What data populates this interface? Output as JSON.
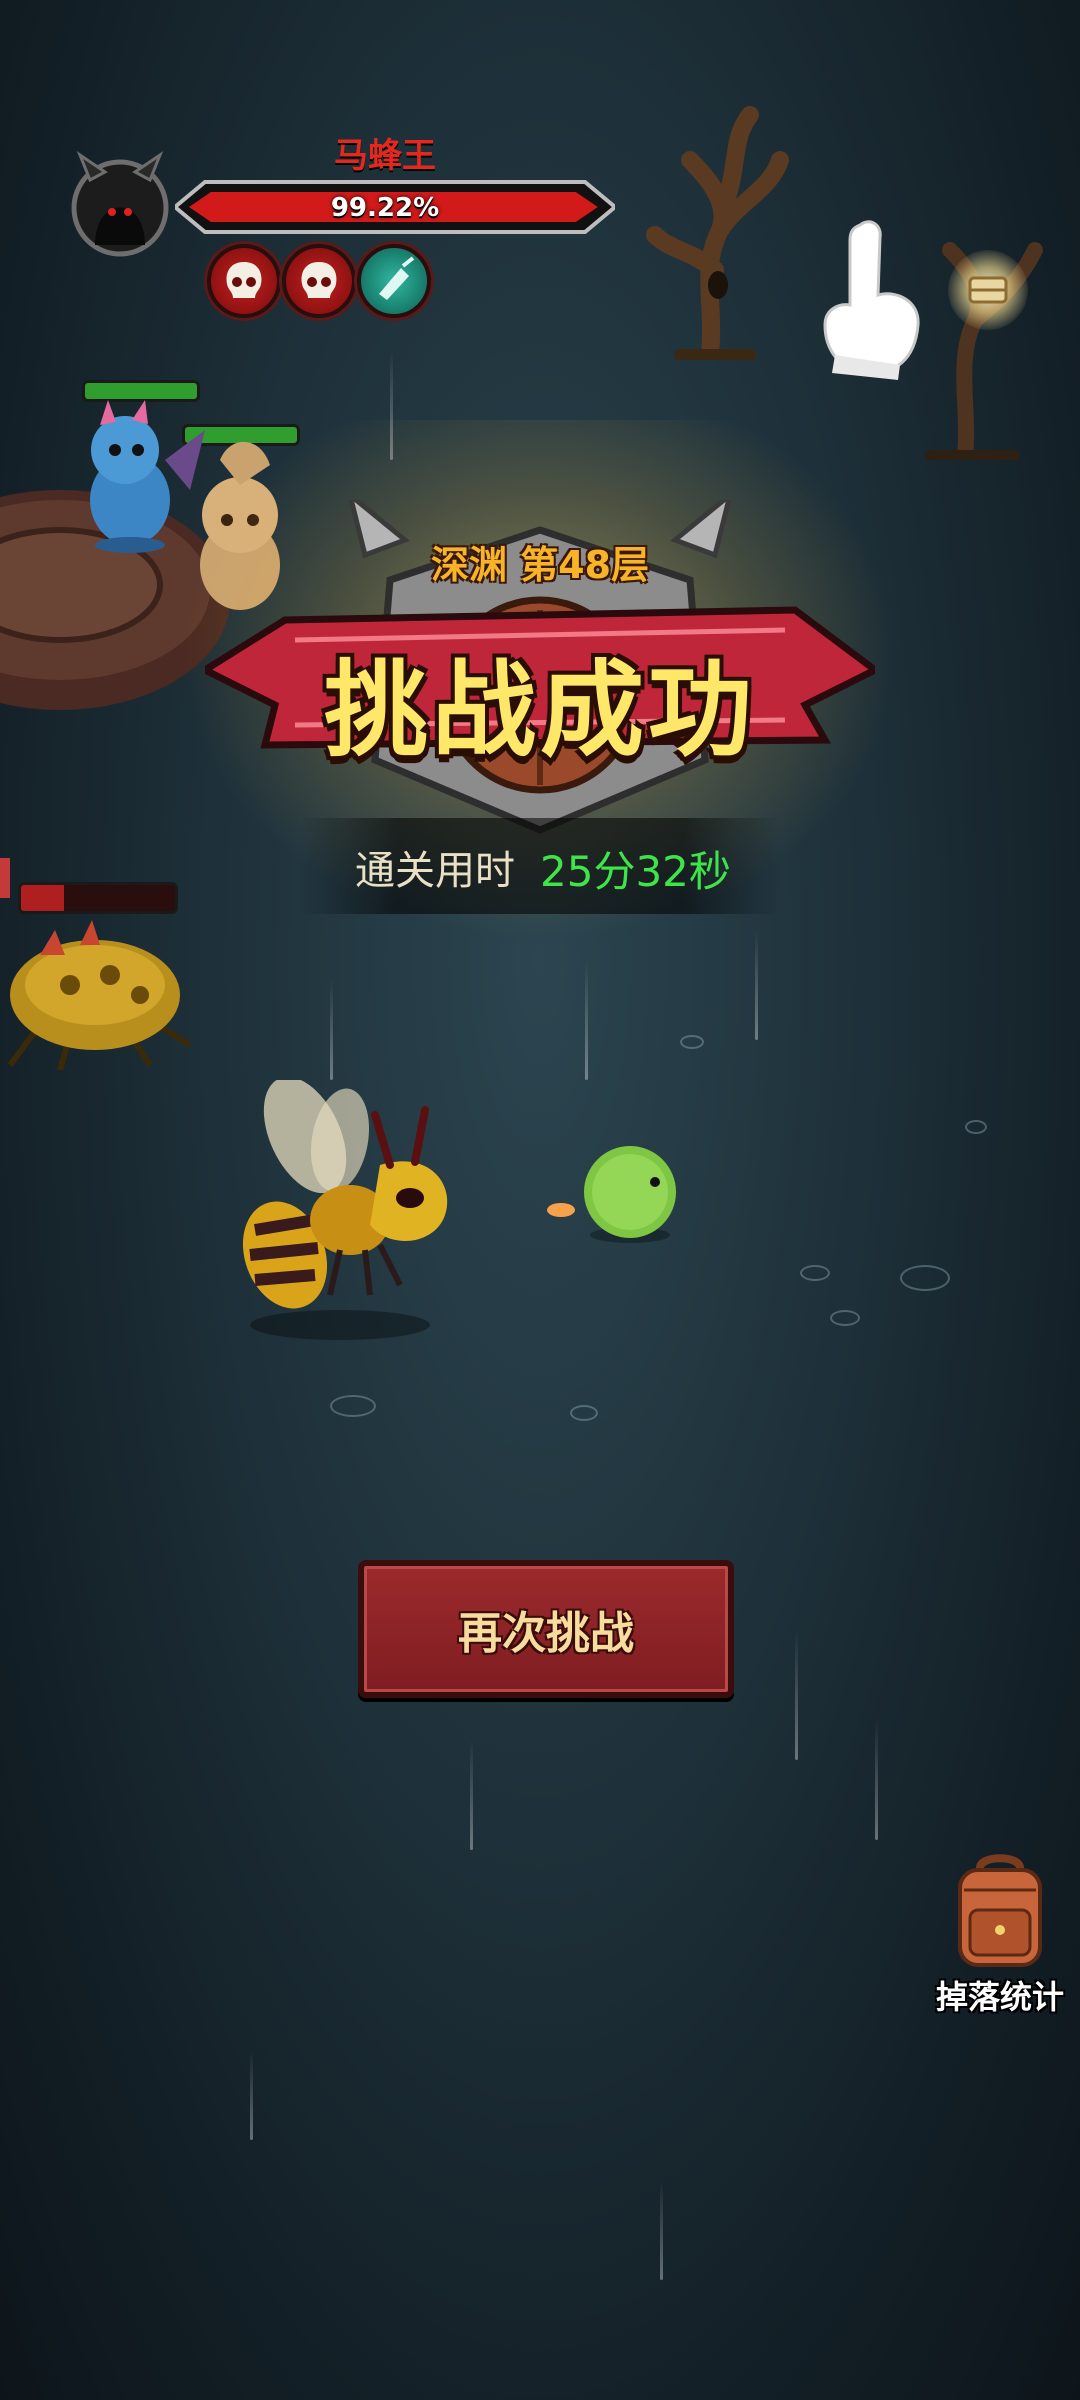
{
  "boss": {
    "name": "马蜂王",
    "hp_percent_label": "99.22%",
    "hp_fraction": 0.9922,
    "buffs": [
      "skull-buff-icon",
      "skull-buff-icon",
      "sweep-buff-icon"
    ]
  },
  "victory": {
    "floor": "深渊 第48层",
    "title": "挑战成功",
    "time_label": "通关用时",
    "time_value": "25分32秒"
  },
  "actions": {
    "retry_label": "再次挑战",
    "drop_stats_label": "掉落统计"
  },
  "colors": {
    "boss_name": "#e4281e",
    "hp_fill": "#d21a1a",
    "floor_text": "#f7b428",
    "title_text": "#ffe76a",
    "time_value": "#3ee54a",
    "button": "#8a2327"
  }
}
